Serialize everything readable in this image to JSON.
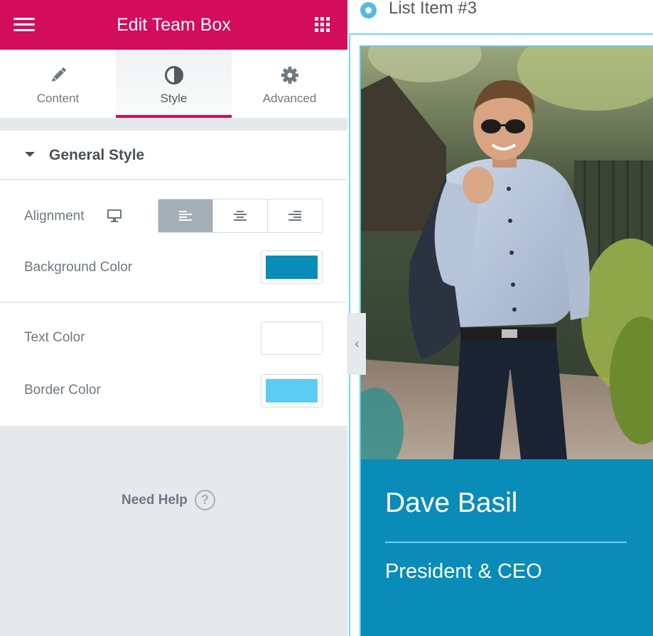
{
  "header": {
    "title": "Edit Team Box",
    "menu_icon": "hamburger-menu-icon",
    "apps_icon": "grid-apps-icon"
  },
  "tabs": [
    {
      "label": "Content",
      "icon": "pencil-icon",
      "active": false
    },
    {
      "label": "Style",
      "icon": "half-circle-contrast-icon",
      "active": true
    },
    {
      "label": "Advanced",
      "icon": "gear-icon",
      "active": false
    }
  ],
  "section": {
    "title": "General Style",
    "expanded": true
  },
  "controls": {
    "alignment": {
      "label": "Alignment",
      "device_icon": "desktop-monitor-icon",
      "options": [
        "left",
        "center",
        "right"
      ],
      "selected": "left"
    },
    "background_color": {
      "label": "Background Color",
      "value": "#0a8cb9"
    },
    "text_color": {
      "label": "Text Color",
      "value": "#ffffff"
    },
    "border_color": {
      "label": "Border Color",
      "value": "#5ccbf2"
    }
  },
  "help": {
    "label": "Need Help",
    "icon": "question-circle-icon"
  },
  "collapse_icon": "chevron-left-icon",
  "preview": {
    "list_item": "List Item #3",
    "team": {
      "name": "Dave Basil",
      "role": "President & CEO"
    }
  },
  "colors": {
    "brand": "#d30c5c",
    "panel_bg": "#e6e9ec",
    "accent_blue": "#0a8cb9",
    "light_blue": "#5ccbf2"
  }
}
